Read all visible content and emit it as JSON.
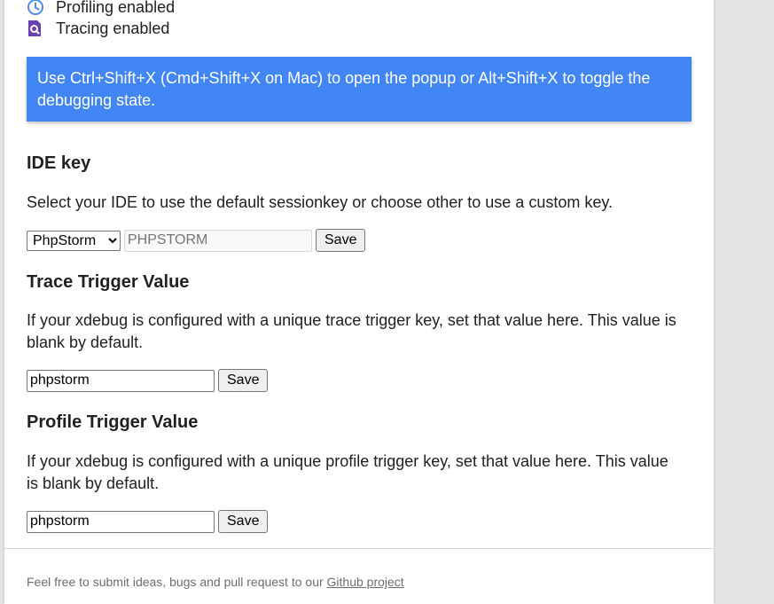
{
  "status": {
    "profiling_label": "Profiling enabled",
    "profiling_icon": "clock-icon",
    "tracing_label": "Tracing enabled",
    "tracing_icon": "search-document-icon"
  },
  "banner": {
    "text": "Use Ctrl+Shift+X (Cmd+Shift+X on Mac) to open the popup or Alt+Shift+X to toggle the debugging state.",
    "color": "#4285f4"
  },
  "ide_key": {
    "heading": "IDE key",
    "description": "Select your IDE to use the default sessionkey or choose other to use a custom key.",
    "selected_option": "PhpStorm",
    "key_placeholder": "PHPSTORM",
    "key_value": "",
    "save_label": "Save"
  },
  "trace_trigger": {
    "heading": "Trace Trigger Value",
    "description": "If your xdebug is configured with a unique trace trigger key, set that value here. This value is blank by default.",
    "value": "phpstorm",
    "save_label": "Save"
  },
  "profile_trigger": {
    "heading": "Profile Trigger Value",
    "description": "If your xdebug is configured with a unique profile trigger key, set that value here. This value is blank by default.",
    "value": "phpstorm",
    "save_label": "Save"
  },
  "footer": {
    "text": "Feel free to submit ideas, bugs and pull request to our ",
    "link_label": "Github project"
  }
}
